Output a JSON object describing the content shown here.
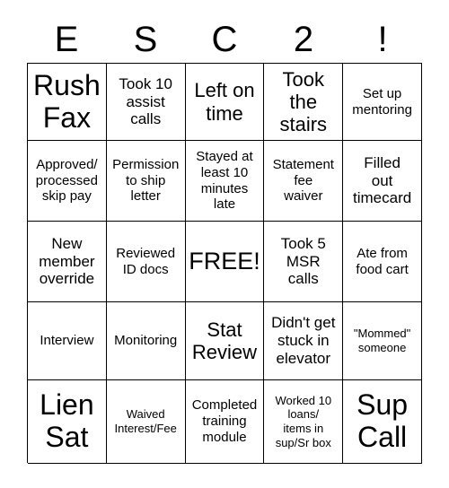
{
  "card": {
    "header_letters": [
      "E",
      "S",
      "C",
      "2",
      "!"
    ],
    "rows": [
      [
        {
          "text": "Rush\nFax",
          "size": "xxl"
        },
        {
          "text": "Took 10\nassist\ncalls",
          "size": "md"
        },
        {
          "text": "Left on\ntime",
          "size": "lg"
        },
        {
          "text": "Took\nthe\nstairs",
          "size": "lg"
        },
        {
          "text": "Set up\nmentoring",
          "size": "sm"
        }
      ],
      [
        {
          "text": "Approved/\nprocessed\nskip pay",
          "size": "sm"
        },
        {
          "text": "Permission\nto ship\nletter",
          "size": "sm"
        },
        {
          "text": "Stayed at\nleast 10\nminutes\nlate",
          "size": "sm"
        },
        {
          "text": "Statement\nfee\nwaiver",
          "size": "sm"
        },
        {
          "text": "Filled\nout\ntimecard",
          "size": "md"
        }
      ],
      [
        {
          "text": "New\nmember\noverride",
          "size": "md"
        },
        {
          "text": "Reviewed\nID docs",
          "size": "sm"
        },
        {
          "text": "FREE!",
          "size": "xl"
        },
        {
          "text": "Took 5\nMSR\ncalls",
          "size": "md"
        },
        {
          "text": "Ate from\nfood cart",
          "size": "sm"
        }
      ],
      [
        {
          "text": "Interview",
          "size": "sm"
        },
        {
          "text": "Monitoring",
          "size": "sm"
        },
        {
          "text": "Stat\nReview",
          "size": "lg"
        },
        {
          "text": "Didn't get\nstuck in\nelevator",
          "size": "md"
        },
        {
          "text": "\"Mommed\"\nsomeone",
          "size": "xs"
        }
      ],
      [
        {
          "text": "Lien\nSat",
          "size": "xxl"
        },
        {
          "text": "Waived\nInterest/Fee",
          "size": "xs"
        },
        {
          "text": "Completed\ntraining\nmodule",
          "size": "sm"
        },
        {
          "text": "Worked 10\nloans/\nitems in\nsup/Sr box",
          "size": "xs"
        },
        {
          "text": "Sup\nCall",
          "size": "xxl"
        }
      ]
    ]
  }
}
